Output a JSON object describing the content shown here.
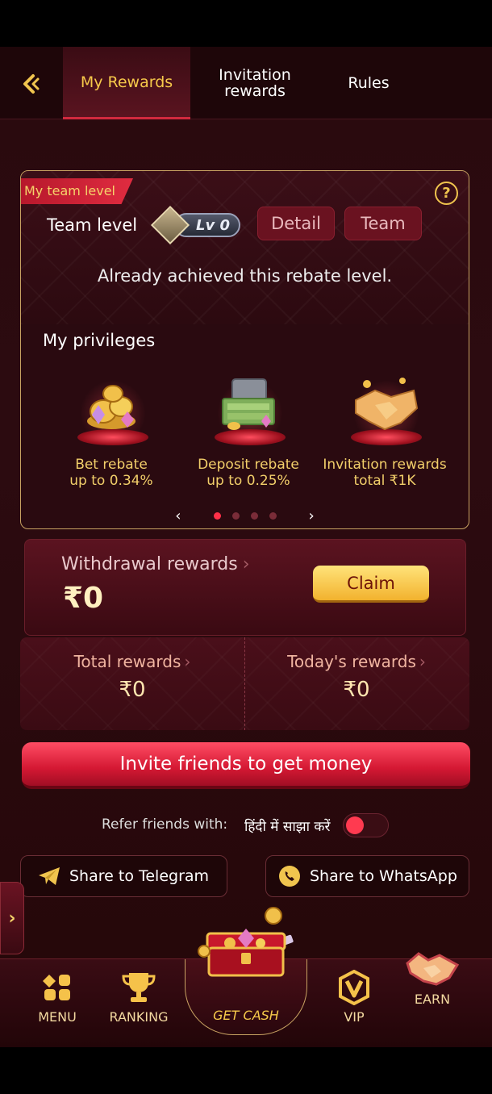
{
  "header": {
    "tabs": [
      {
        "label": "My Rewards",
        "active": true
      },
      {
        "label": "Invitation rewards",
        "active": false
      },
      {
        "label": "Rules",
        "active": false
      }
    ]
  },
  "team": {
    "ribbon": "My team level",
    "label": "Team level",
    "level_badge": "Lv 0",
    "detail_btn": "Detail",
    "team_btn": "Team",
    "status": "Already achieved this rebate level.",
    "privileges_title": "My privileges",
    "privileges": [
      {
        "name": "Bet rebate",
        "value": "up to 0.34%",
        "icon": "coins-gems-icon"
      },
      {
        "name": "Deposit rebate",
        "value": "up to 0.25%",
        "icon": "cash-chest-icon"
      },
      {
        "name": "Invitation rewards",
        "value": "total ₹1K",
        "icon": "handshake-icon"
      }
    ],
    "pager": {
      "pages": 4,
      "current": 1
    }
  },
  "withdraw": {
    "label": "Withdrawal rewards",
    "amount": "₹0",
    "claim_btn": "Claim"
  },
  "rewards": {
    "total_label": "Total rewards",
    "total_value": "₹0",
    "today_label": "Today's rewards",
    "today_value": "₹0"
  },
  "invite_btn": "Invite friends to get money",
  "refer": {
    "label": "Refer friends with:",
    "language": "हिंदी में साझा करें",
    "toggle_on": false
  },
  "share": {
    "telegram": "Share to Telegram",
    "whatsapp": "Share to WhatsApp"
  },
  "nav": {
    "menu": "MENU",
    "ranking": "RANKING",
    "get_cash": "GET CASH",
    "vip": "VIP",
    "earn": "EARN"
  },
  "colors": {
    "accent_gold": "#f2cf6a",
    "accent_red": "#d41833",
    "background": "#2a0a0e"
  }
}
